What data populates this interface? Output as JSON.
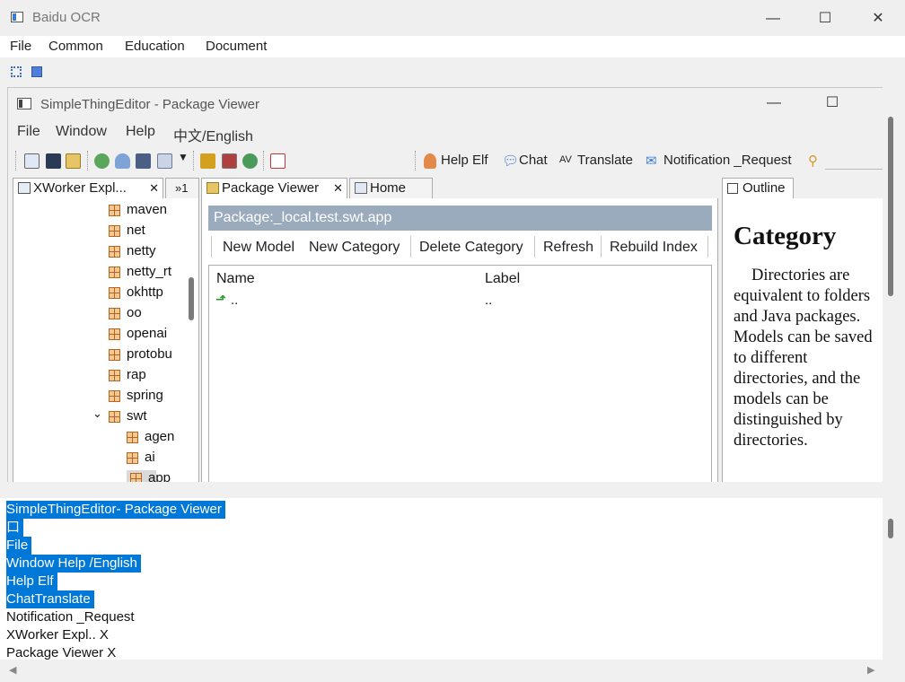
{
  "outer": {
    "title": "Baidu OCR",
    "menu": [
      "File",
      "Common",
      "Education",
      "Document"
    ],
    "window_controls": {
      "minimize": "—",
      "maximize": "☐",
      "close": "✕"
    }
  },
  "inner": {
    "title": "SimpleThingEditor - Package Viewer",
    "menu": [
      "File",
      "Window",
      "Help",
      "中文/English"
    ],
    "toolbar": {
      "help_elf": "Help Elf",
      "chat": "Chat",
      "translate": "Translate",
      "notification": "Notification _Request"
    },
    "explorer": {
      "tab_label": "XWorker Expl...",
      "tab_close": "✕",
      "overflow_label": "»1",
      "items": [
        "maven",
        "net",
        "netty",
        "netty_rt",
        "okhttp",
        "oo",
        "openai",
        "protobu",
        "rap",
        "spring",
        "swt",
        "agen",
        "ai",
        "app"
      ],
      "expand_glyph": "⌄"
    },
    "editor": {
      "tabs": [
        {
          "label": "Package Viewer",
          "close": "✕"
        },
        {
          "label": "Home"
        }
      ],
      "package_header": "Package:_local.test.swt.app",
      "actions": [
        "New Model",
        "New Category",
        "Delete Category",
        "Refresh",
        "Rebuild Index"
      ],
      "columns": {
        "name": "Name",
        "label": "Label"
      },
      "rows": [
        {
          "name": "..",
          "label": ".."
        }
      ]
    },
    "outline": {
      "tab_label": "Outline",
      "heading": "Category",
      "body": "Directories are equivalent to folders and Java packages. Models can be saved to different directories, and the models can be distinguished by directories."
    }
  },
  "ocr_result": {
    "lines": [
      {
        "text": "SimpleThingEditor- Package Viewer",
        "selected": true
      },
      {
        "text": "口",
        "selected": true
      },
      {
        "text": "File",
        "selected": true
      },
      {
        "text": "Window Help /English",
        "selected": true
      },
      {
        "text": "Help Elf",
        "selected": true
      },
      {
        "text": "ChatTranslate",
        "selected": true
      },
      {
        "text": "Notification _Request",
        "selected": false
      },
      {
        "text": "XWorker Expl.. X",
        "selected": false
      },
      {
        "text": "Package Viewer X",
        "selected": false
      }
    ]
  },
  "colors": {
    "selection": "#0078d7",
    "package_header": "#9aabbd",
    "accent_blue": "#3a7bd5"
  },
  "icons": [
    "app-icon",
    "home-icon",
    "save-icon",
    "open-folder-icon",
    "refresh-icon",
    "user-icon",
    "monitor-icon",
    "copy-icon",
    "dropdown-icon",
    "tools-icon",
    "lock-icon",
    "globe-icon",
    "pdf-icon",
    "search-icon",
    "package-icon",
    "up-arrow-icon",
    "chat-icon",
    "translate-icon",
    "mail-icon"
  ]
}
